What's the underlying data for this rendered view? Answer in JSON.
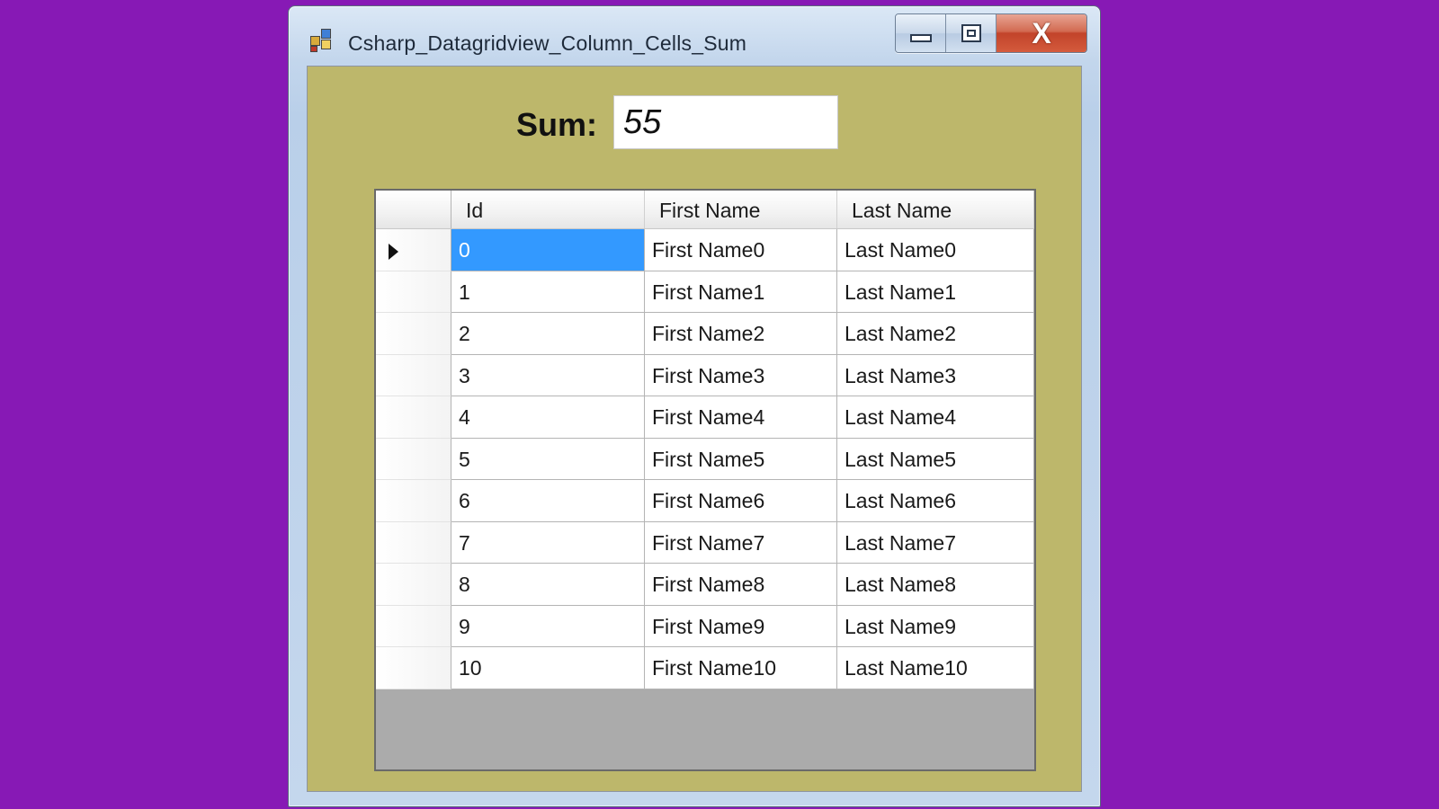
{
  "window": {
    "title": "Csharp_Datagridview_Column_Cells_Sum",
    "icon": "winforms-app-icon",
    "controls": [
      "minimize-icon",
      "maximize-icon",
      "close-icon"
    ],
    "close_glyph": "X"
  },
  "sum": {
    "label": "Sum:",
    "value": "55"
  },
  "grid": {
    "columns": [
      "Id",
      "First Name",
      "Last Name"
    ],
    "rows": [
      [
        "0",
        "First Name0",
        "Last Name0"
      ],
      [
        "1",
        "First Name1",
        "Last Name1"
      ],
      [
        "2",
        "First Name2",
        "Last Name2"
      ],
      [
        "3",
        "First Name3",
        "Last Name3"
      ],
      [
        "4",
        "First Name4",
        "Last Name4"
      ],
      [
        "5",
        "First Name5",
        "Last Name5"
      ],
      [
        "6",
        "First Name6",
        "Last Name6"
      ],
      [
        "7",
        "First Name7",
        "Last Name7"
      ],
      [
        "8",
        "First Name8",
        "Last Name8"
      ],
      [
        "9",
        "First Name9",
        "Last Name9"
      ],
      [
        "10",
        "First Name10",
        "Last Name10"
      ]
    ],
    "current_row": 0,
    "selected_cell_color": "#3399ff"
  },
  "colors": {
    "background": "#8719b5",
    "form_background": "#bdb76b",
    "grid_empty_area": "#ababab"
  }
}
